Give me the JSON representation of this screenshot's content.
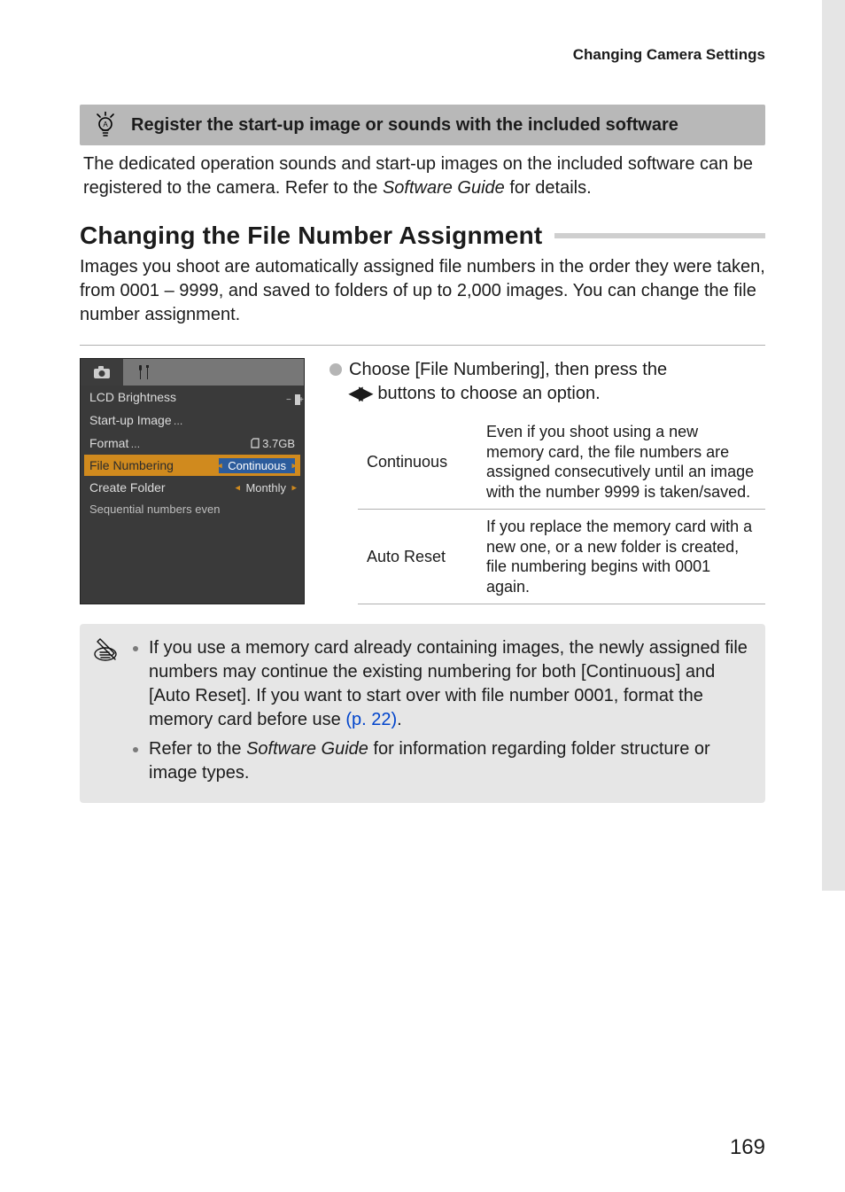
{
  "running_head": "Changing Camera Settings",
  "callout": {
    "title": "Register the start-up image or sounds with the included software",
    "body_prefix": "The dedicated operation sounds and start-up images on the included software can be registered to the camera. Refer to the ",
    "body_guide": "Software Guide",
    "body_suffix": " for details."
  },
  "section": {
    "title": "Changing the File Number Assignment",
    "lead": "Images you shoot are automatically assigned file numbers in the order they were taken, from 0001 – 9999, and saved to folders of up to 2,000 images. You can change the file number assignment."
  },
  "lcd": {
    "rows": {
      "brightness_label": "LCD Brightness",
      "startup_label": "Start-up Image",
      "format_label": "Format",
      "format_value": "3.7GB",
      "filenum_label": "File Numbering",
      "filenum_value": "Continuous",
      "createfolder_label": "Create Folder",
      "createfolder_value": "Monthly"
    },
    "hint": "Sequential numbers even"
  },
  "step": {
    "line1": "Choose [File Numbering], then press the ",
    "line2_after_arrows": " buttons to choose an option."
  },
  "options": {
    "continuous": {
      "key": "Continuous",
      "desc": "Even if you shoot using a new memory card, the file numbers are assigned consecutively until an image with the number 9999 is taken/saved."
    },
    "autoreset": {
      "key": "Auto Reset",
      "desc": "If you replace the memory card with a new one, or a new folder is created, file numbering begins with 0001 again."
    }
  },
  "tip": {
    "item1_prefix": "If you use a memory card already containing images, the newly assigned file numbers may continue the existing numbering for both [Continuous] and [Auto Reset]. If you want to start over with file number 0001, format the memory card before use ",
    "item1_link": "(p. 22)",
    "item1_suffix": ".",
    "item2_prefix": "Refer to the ",
    "item2_guide": "Software Guide",
    "item2_suffix": " for information regarding folder structure or image types."
  },
  "page_number": "169"
}
